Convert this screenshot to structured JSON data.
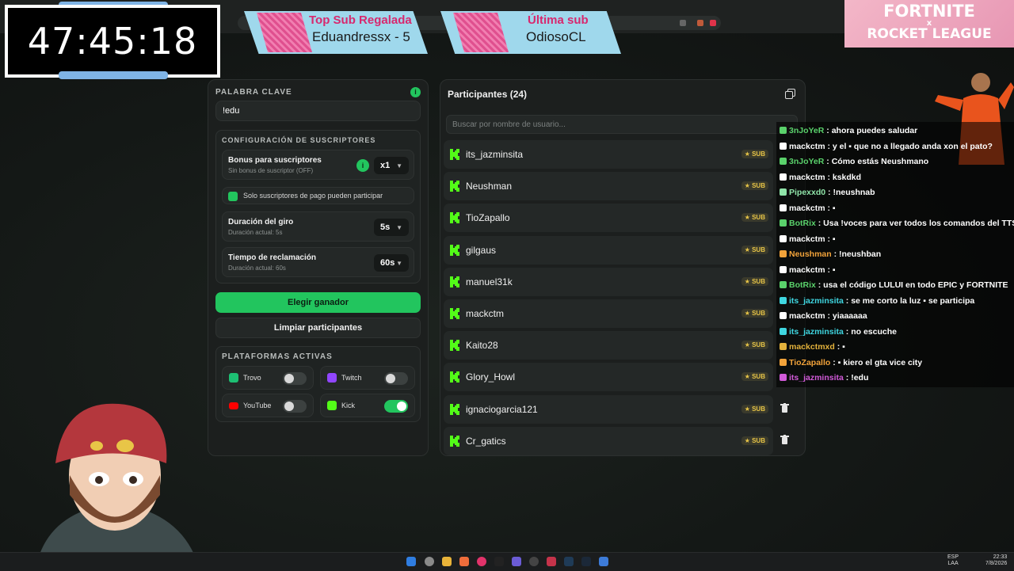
{
  "timer": {
    "value": "47:45:18"
  },
  "banners": [
    {
      "title": "Top Sub Regalada",
      "value": "Eduandressx - 5"
    },
    {
      "title": "Última sub",
      "value": "OdiosoCL"
    }
  ],
  "logo": {
    "line1": "FORTNITE",
    "line2": "x",
    "line3": "ROCKET LEAGUE"
  },
  "config": {
    "keyword_label": "PALABRA CLAVE",
    "keyword_value": "!edu",
    "info_glyph": "i",
    "subs_section": "CONFIGURACIÓN DE SUSCRIPTORES",
    "bonus_title": "Bonus para suscriptores",
    "bonus_desc": "Sin bonus de suscriptor (OFF)",
    "bonus_value": "x1",
    "paid_only_label": "Solo suscriptores de pago pueden participar",
    "spin_title": "Duración del giro",
    "spin_desc": "Duración actual: 5s",
    "spin_value": "5s",
    "claim_title": "Tiempo de reclamación",
    "claim_desc": "Duración actual: 60s",
    "claim_value": "60s",
    "pick_winner": "Elegir ganador",
    "clear_participants": "Limpiar participantes",
    "platforms_label": "PLATAFORMAS ACTIVAS",
    "platforms": [
      {
        "name": "Trovo",
        "color": "#1dbf73",
        "enabled": false
      },
      {
        "name": "Twitch",
        "color": "#9146ff",
        "enabled": false
      },
      {
        "name": "YouTube",
        "color": "#ff0000",
        "enabled": false
      },
      {
        "name": "Kick",
        "color": "#53fc18",
        "enabled": true
      }
    ]
  },
  "participants": {
    "title": "Participantes (24)",
    "search_placeholder": "Buscar por nombre de usuario...",
    "badge": "★ SUB",
    "list": [
      "its_jazminsita",
      "Neushman",
      "TioZapallo",
      "gilgaus",
      "manuel31k",
      "mackctm",
      "Kaito28",
      "Glory_Howl",
      "ignaciogarcia121",
      "Cr_gatics"
    ]
  },
  "chat": [
    {
      "user": "3nJoYeR",
      "color": "#5ad16b",
      "text": ": ahora puedes saludar"
    },
    {
      "user": "mackctm",
      "color": "#ffffff",
      "text": ": y el  ▪  que no a llegado anda xon el pato?"
    },
    {
      "user": "3nJoYeR",
      "color": "#5ad16b",
      "text": ": Cómo estás Neushmano"
    },
    {
      "user": "mackctm",
      "color": "#ffffff",
      "text": ": kskdkd"
    },
    {
      "user": "Pipexxd0",
      "color": "#8fe3a8",
      "text": ": !neushnab"
    },
    {
      "user": "mackctm",
      "color": "#ffffff",
      "text": ":  ▪"
    },
    {
      "user": "BotRix",
      "color": "#5ad16b",
      "text": ": Usa !voces para ver todos los comandos del TTS"
    },
    {
      "user": "mackctm",
      "color": "#ffffff",
      "text": ":  ▪"
    },
    {
      "user": "Neushman",
      "color": "#f2a33a",
      "text": ": !neushban"
    },
    {
      "user": "mackctm",
      "color": "#ffffff",
      "text": ":  ▪"
    },
    {
      "user": "BotRix",
      "color": "#5ad16b",
      "text": ": usa el código LULUI en todo EPIC y FORTNITE"
    },
    {
      "user": "its_jazminsita",
      "color": "#3fd6e0",
      "text": ": se me corto la luz  ▪  se participa"
    },
    {
      "user": "mackctm",
      "color": "#ffffff",
      "text": ": yiaaaaaa"
    },
    {
      "user": "its_jazminsita",
      "color": "#3fd6e0",
      "text": ": no escuche"
    },
    {
      "user": "mackctmxd",
      "color": "#e3b23c",
      "text": ":  ▪"
    },
    {
      "user": "TioZapallo",
      "color": "#f2a33a",
      "text": ":  ▪  kiero el gta vice city"
    },
    {
      "user": "its_jazminsita",
      "color": "#d15ad8",
      "text": ": !edu"
    }
  ],
  "taskbar": {
    "lang_top": "ESP",
    "lang_bottom": "LAA",
    "time": "22:33",
    "date": "7/8/2026"
  },
  "icons": {
    "copy": "copy-icon",
    "trash": "trash-icon",
    "info": "info-icon"
  }
}
